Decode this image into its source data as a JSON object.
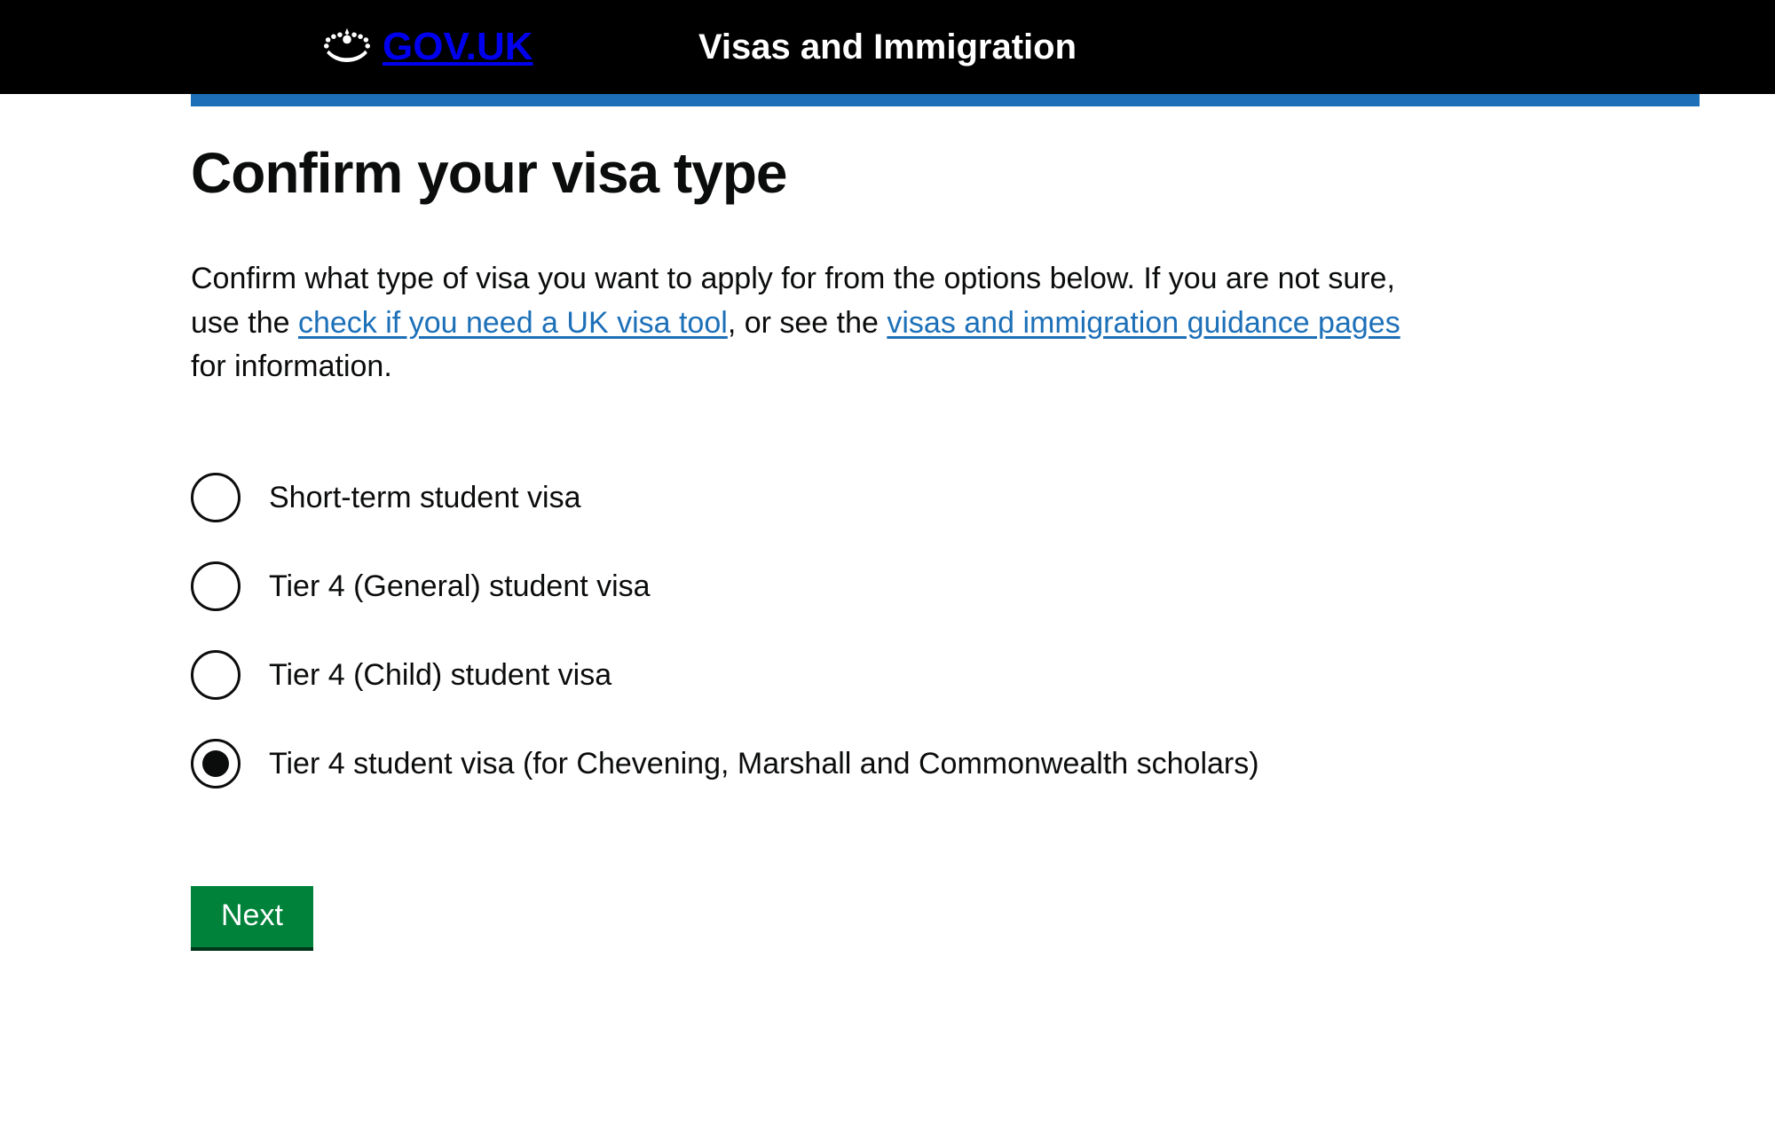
{
  "header": {
    "site": "GOV.UK",
    "service": "Visas and Immigration"
  },
  "page": {
    "title": "Confirm your visa type",
    "intro_parts": {
      "p1": "Confirm what type of visa you want to apply for from the options below. If you are not sure, use the ",
      "link1": "check if you need a UK visa tool",
      "p2": ", or see the ",
      "link2": "visas and immigration guidance pages",
      "p3": " for information."
    }
  },
  "radios": {
    "selected_index": 3,
    "options": [
      {
        "label": "Short-term student visa"
      },
      {
        "label": "Tier 4 (General) student visa"
      },
      {
        "label": "Tier 4 (Child) student visa"
      },
      {
        "label": "Tier 4 student visa (for Chevening, Marshall and Commonwealth scholars)"
      }
    ]
  },
  "actions": {
    "next": "Next"
  }
}
